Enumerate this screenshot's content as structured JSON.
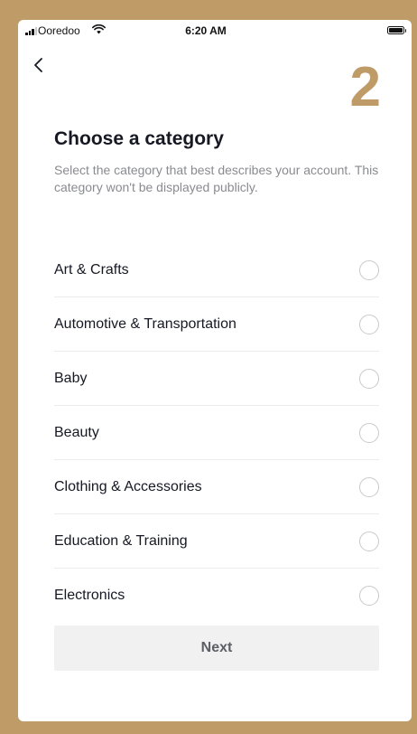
{
  "status_bar": {
    "carrier": "Ooredoo",
    "time": "6:20 AM"
  },
  "header": {
    "back_icon": "chevron-left-icon",
    "step_number": "2"
  },
  "main": {
    "title": "Choose a category",
    "subtitle": "Select the category that best describes your account. This category won't be displayed publicly.",
    "categories": [
      {
        "label": "Art & Crafts",
        "selected": false
      },
      {
        "label": "Automotive & Transportation",
        "selected": false
      },
      {
        "label": "Baby",
        "selected": false
      },
      {
        "label": "Beauty",
        "selected": false
      },
      {
        "label": "Clothing & Accessories",
        "selected": false
      },
      {
        "label": "Education & Training",
        "selected": false
      },
      {
        "label": "Electronics",
        "selected": false
      }
    ],
    "next_label": "Next"
  },
  "colors": {
    "frame": "#bf9b67",
    "step_number": "#bf9b67",
    "title_text": "#161823",
    "subtitle_text": "#8a8b91",
    "button_bg": "#f1f1f2",
    "button_text": "#5e5f66"
  }
}
